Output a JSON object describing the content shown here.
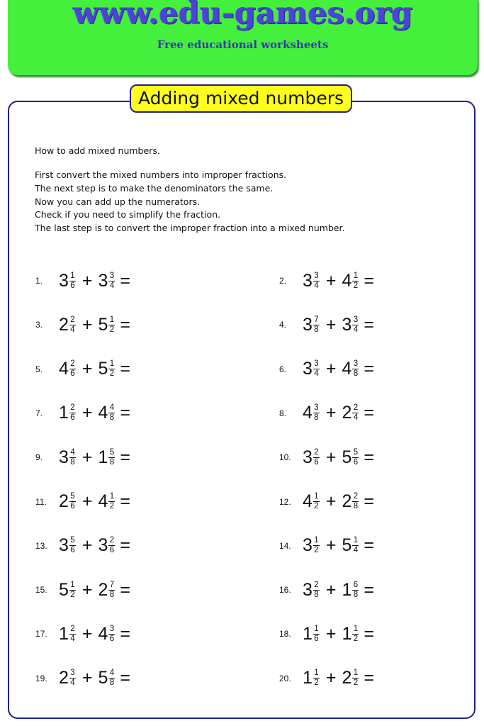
{
  "header": {
    "site_title": "www.edu-games.org",
    "subtitle": "Free educational worksheets",
    "banner_color": "#44f03c",
    "title_color": "#4b44d6"
  },
  "worksheet": {
    "title": "Adding mixed numbers",
    "badge_color": "#ffff1e",
    "border_color": "#1f1f8a",
    "intro": "How to add mixed numbers.",
    "steps": [
      "First convert the mixed numbers into improper fractions.",
      "The next step is to make the denominators the same.",
      "Now you can add up the numerators.",
      "Check if you need to simplify the fraction.",
      "The last step is to convert the improper fraction into a mixed number."
    ],
    "problems": [
      {
        "n": "1.",
        "a": {
          "w": "3",
          "num": "1",
          "den": "6"
        },
        "b": {
          "w": "3",
          "num": "3",
          "den": "4"
        }
      },
      {
        "n": "2.",
        "a": {
          "w": "3",
          "num": "3",
          "den": "4"
        },
        "b": {
          "w": "4",
          "num": "1",
          "den": "2"
        }
      },
      {
        "n": "3.",
        "a": {
          "w": "2",
          "num": "2",
          "den": "4"
        },
        "b": {
          "w": "5",
          "num": "1",
          "den": "2"
        }
      },
      {
        "n": "4.",
        "a": {
          "w": "3",
          "num": "7",
          "den": "8"
        },
        "b": {
          "w": "3",
          "num": "3",
          "den": "4"
        }
      },
      {
        "n": "5.",
        "a": {
          "w": "4",
          "num": "2",
          "den": "6"
        },
        "b": {
          "w": "5",
          "num": "1",
          "den": "2"
        }
      },
      {
        "n": "6.",
        "a": {
          "w": "3",
          "num": "3",
          "den": "4"
        },
        "b": {
          "w": "4",
          "num": "3",
          "den": "8"
        }
      },
      {
        "n": "7.",
        "a": {
          "w": "1",
          "num": "2",
          "den": "6"
        },
        "b": {
          "w": "4",
          "num": "4",
          "den": "8"
        }
      },
      {
        "n": "8.",
        "a": {
          "w": "4",
          "num": "3",
          "den": "8"
        },
        "b": {
          "w": "2",
          "num": "2",
          "den": "4"
        }
      },
      {
        "n": "9.",
        "a": {
          "w": "3",
          "num": "4",
          "den": "8"
        },
        "b": {
          "w": "1",
          "num": "5",
          "den": "8"
        }
      },
      {
        "n": "10.",
        "a": {
          "w": "3",
          "num": "2",
          "den": "6"
        },
        "b": {
          "w": "5",
          "num": "5",
          "den": "6"
        }
      },
      {
        "n": "11.",
        "a": {
          "w": "2",
          "num": "5",
          "den": "6"
        },
        "b": {
          "w": "4",
          "num": "1",
          "den": "2"
        }
      },
      {
        "n": "12.",
        "a": {
          "w": "4",
          "num": "1",
          "den": "2"
        },
        "b": {
          "w": "2",
          "num": "2",
          "den": "8"
        }
      },
      {
        "n": "13.",
        "a": {
          "w": "3",
          "num": "5",
          "den": "6"
        },
        "b": {
          "w": "3",
          "num": "2",
          "den": "6"
        }
      },
      {
        "n": "14.",
        "a": {
          "w": "3",
          "num": "1",
          "den": "2"
        },
        "b": {
          "w": "5",
          "num": "1",
          "den": "4"
        }
      },
      {
        "n": "15.",
        "a": {
          "w": "5",
          "num": "1",
          "den": "2"
        },
        "b": {
          "w": "2",
          "num": "7",
          "den": "8"
        }
      },
      {
        "n": "16.",
        "a": {
          "w": "3",
          "num": "2",
          "den": "8"
        },
        "b": {
          "w": "1",
          "num": "6",
          "den": "8"
        }
      },
      {
        "n": "17.",
        "a": {
          "w": "1",
          "num": "2",
          "den": "4"
        },
        "b": {
          "w": "4",
          "num": "3",
          "den": "6"
        }
      },
      {
        "n": "18.",
        "a": {
          "w": "1",
          "num": "1",
          "den": "6"
        },
        "b": {
          "w": "1",
          "num": "1",
          "den": "2"
        }
      },
      {
        "n": "19.",
        "a": {
          "w": "2",
          "num": "3",
          "den": "4"
        },
        "b": {
          "w": "5",
          "num": "4",
          "den": "8"
        }
      },
      {
        "n": "20.",
        "a": {
          "w": "1",
          "num": "1",
          "den": "2"
        },
        "b": {
          "w": "2",
          "num": "1",
          "den": "2"
        }
      }
    ],
    "plus_sign": "+",
    "equals_sign": "="
  }
}
